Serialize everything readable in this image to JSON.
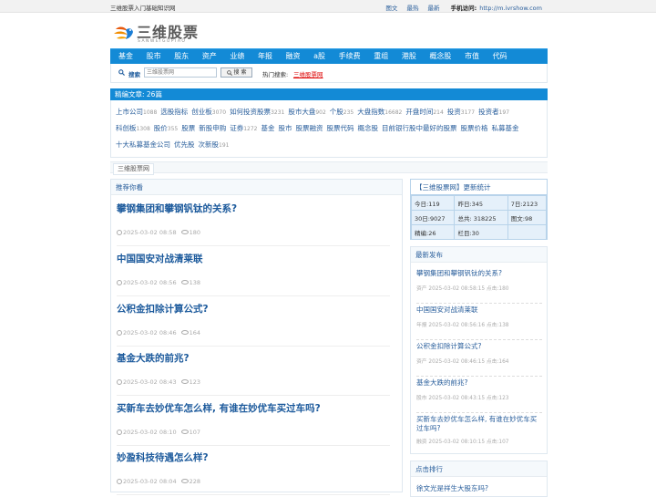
{
  "topbar": {
    "site_tagline": "三维股票入门基础知识网",
    "links": [
      "图文",
      "最热",
      "最新"
    ],
    "mobile_label": "手机访问:",
    "mobile_url": "http://m.ivrshow.com"
  },
  "logo": {
    "name": "三维股票",
    "pinyin": "SANWEIGUPIAO"
  },
  "nav": [
    "基金",
    "股市",
    "股东",
    "资产",
    "业绩",
    "年报",
    "融资",
    "a股",
    "手续费",
    "重组",
    "港股",
    "概念股",
    "市值",
    "代码"
  ],
  "search": {
    "label": "搜索",
    "placeholder": "三维股票网",
    "button": "搜 索",
    "hot_label": "热门搜索:",
    "hot_link": "三维股票网"
  },
  "featured": {
    "title": "精编文章: 26篇",
    "rows": [
      [
        {
          "label": "上市公司",
          "count": "1088"
        },
        {
          "label": "选股指标",
          "count": ""
        },
        {
          "label": "创业板",
          "count": "3070"
        },
        {
          "label": "如何投资股票",
          "count": "3231"
        },
        {
          "label": "股市大盘",
          "count": "902"
        },
        {
          "label": "个股",
          "count": "235"
        },
        {
          "label": "大盘指数",
          "count": "16682"
        },
        {
          "label": "开盘时间",
          "count": "214"
        },
        {
          "label": "投资",
          "count": "3177"
        },
        {
          "label": "投资者",
          "count": "197"
        }
      ],
      [
        {
          "label": "科创板",
          "count": "1308"
        },
        {
          "label": "股价",
          "count": "355"
        },
        {
          "label": "股票",
          "count": ""
        },
        {
          "label": "新股申购",
          "count": ""
        },
        {
          "label": "证券",
          "count": "1272"
        },
        {
          "label": "基金",
          "count": ""
        },
        {
          "label": "股市",
          "count": ""
        },
        {
          "label": "股票融资",
          "count": ""
        },
        {
          "label": "股票代码",
          "count": ""
        },
        {
          "label": "概念股",
          "count": ""
        },
        {
          "label": "目前银行股中最好的股票",
          "count": ""
        },
        {
          "label": "股票价格",
          "count": ""
        },
        {
          "label": "私募基金",
          "count": ""
        }
      ],
      [
        {
          "label": "十大私募基金公司",
          "count": ""
        },
        {
          "label": "优先股",
          "count": ""
        },
        {
          "label": "次新股",
          "count": "191"
        }
      ]
    ]
  },
  "breadcrumb": "三维股票网",
  "main": {
    "heading": "推荐你看",
    "articles": [
      {
        "title": "攀钢集团和攀钢钒钛的关系?",
        "date": "2025-03-02 08:58",
        "views": "180"
      },
      {
        "title": "中国国安对战清莱联",
        "date": "2025-03-02 08:56",
        "views": "138"
      },
      {
        "title": "公积金扣除计算公式?",
        "date": "2025-03-02 08:46",
        "views": "164"
      },
      {
        "title": "基金大跌的前兆?",
        "date": "2025-03-02 08:43",
        "views": "123"
      },
      {
        "title": "买新车去妙优车怎么样, 有谁在妙优车买过车吗?",
        "date": "2025-03-02 08:10",
        "views": "107"
      },
      {
        "title": "妙盈科技待遇怎么样?",
        "date": "2025-03-02 08:04",
        "views": "228"
      }
    ]
  },
  "stats": {
    "heading": "【三维股票网】更新统计",
    "rows": [
      [
        "今日:119",
        "昨日:345",
        "7日:2123"
      ],
      [
        "30日:9027",
        "总共: 318225",
        "图文:98"
      ],
      [
        "精编:26",
        "栏目:30",
        ""
      ]
    ]
  },
  "latest": {
    "heading": "最新发布",
    "items": [
      {
        "title": "攀钢集团和攀钢钒钛的关系?",
        "meta": "资产 2025-03-02 08:58:15  点击:180"
      },
      {
        "title": "中国国安对战清莱联",
        "meta": "年报 2025-03-02 08:56:16  点击:138"
      },
      {
        "title": "公积金扣除计算公式?",
        "meta": "资产 2025-03-02 08:46:15  点击:164"
      },
      {
        "title": "基金大跌的前兆?",
        "meta": "股市 2025-03-02 08:43:15  点击:123"
      },
      {
        "title": "买新车去妙优车怎么样, 有谁在妙优车买过车吗?",
        "meta": "融资 2025-03-02 08:10:15  点击:107"
      }
    ]
  },
  "ranking": {
    "heading": "点击排行",
    "first": "徐文光是祥生大股东吗?"
  },
  "colors": {
    "nav_blue": "#138ad6",
    "link_blue": "#2a5f9c",
    "stats_bg": "#e5f0fa"
  }
}
